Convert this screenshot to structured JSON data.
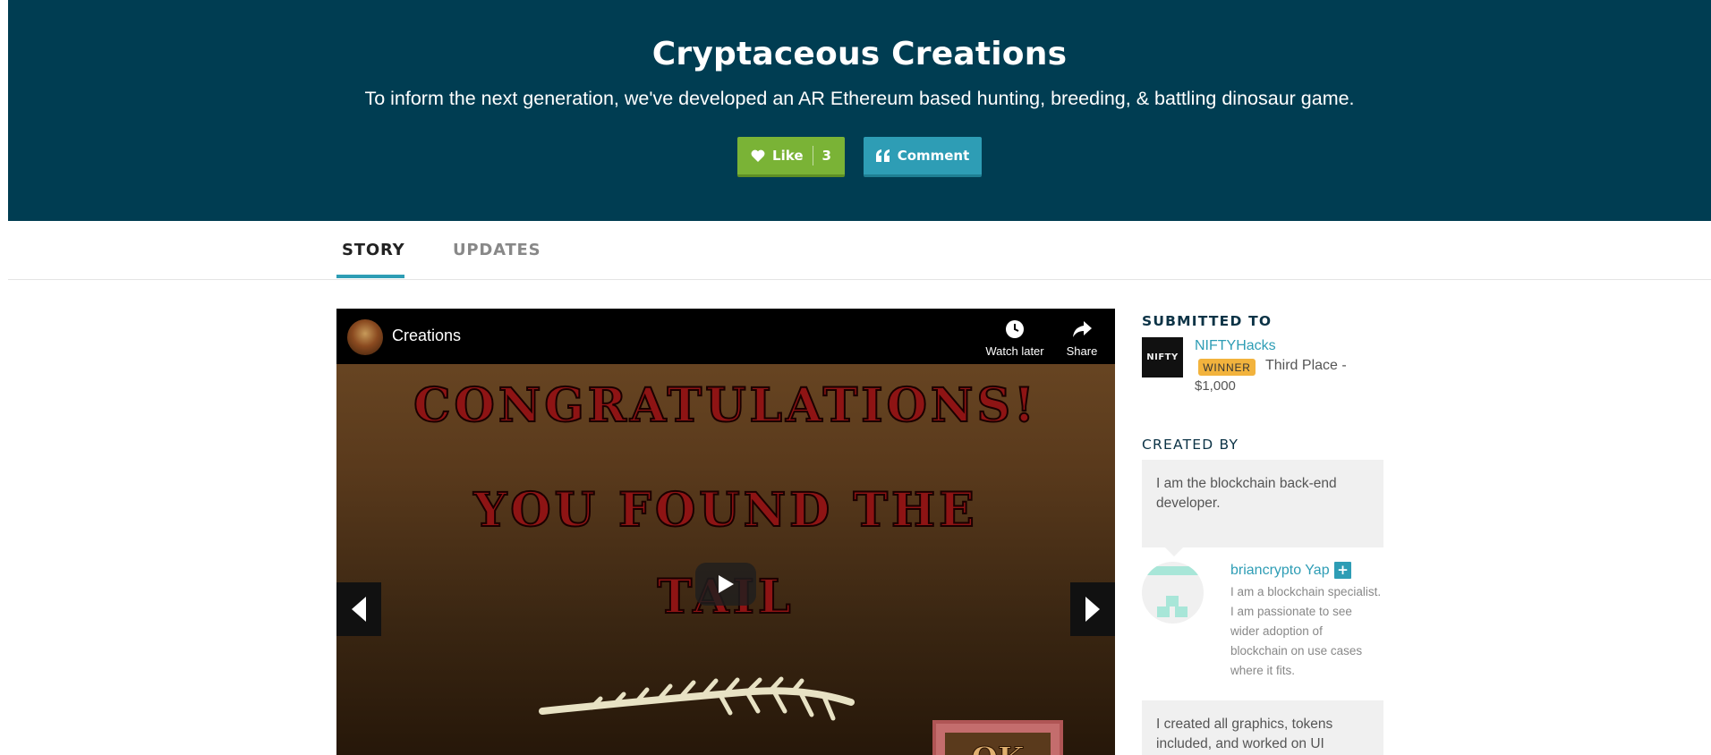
{
  "header": {
    "title": "Cryptaceous Creations",
    "tagline": "To inform the next generation, we've developed an AR Ethereum based hunting, breeding, & battling dinosaur game.",
    "like_label": "Like",
    "like_count": "3",
    "comment_label": "Comment",
    "colors": {
      "background": "#003d52",
      "like": "#7ab336",
      "comment": "#2e9db5"
    }
  },
  "tabs": [
    {
      "label": "STORY",
      "active": true
    },
    {
      "label": "UPDATES",
      "active": false
    }
  ],
  "video": {
    "channel_title": "Creations",
    "watch_later_label": "Watch later",
    "share_label": "Share",
    "frame_text_1": "CONGRATULATIONS!",
    "frame_text_2": "YOU FOUND THE",
    "frame_text_3": "TAIL",
    "ok_label": "OK"
  },
  "sidebar": {
    "submitted_heading": "SUBMITTED TO",
    "hackathon_logo_text": "NIFTY",
    "hackathon_name": "NIFTYHacks",
    "winner_badge": "WINNER",
    "prize_line_1": "Third Place -",
    "prize_line_2": "$1,000",
    "created_heading": "CREATED BY",
    "creators": [
      {
        "contribution": "I am the blockchain back-end developer.",
        "name": "briancrypto Yap",
        "bio": "I am a blockchain specialist. I am passionate to see wider adoption of blockchain on use cases where it fits."
      },
      {
        "contribution": "I created all graphics, tokens included, and worked on UI"
      }
    ]
  }
}
